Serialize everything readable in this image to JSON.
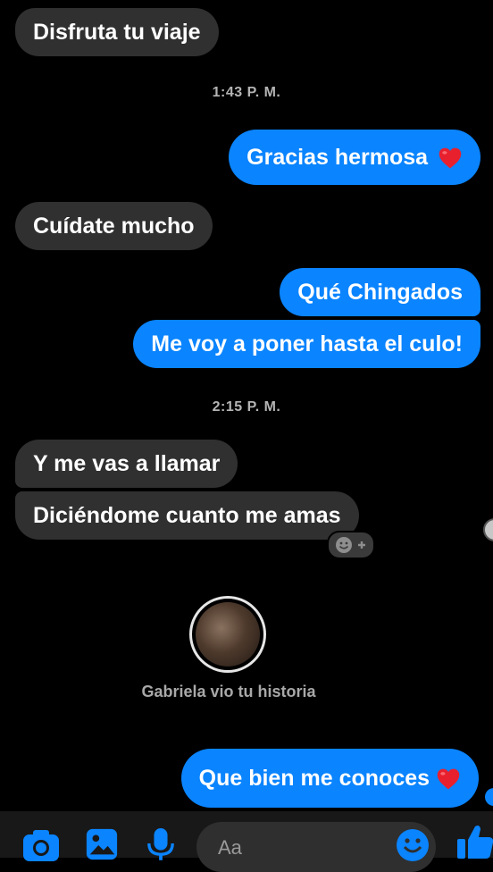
{
  "messages": [
    {
      "text": "Disfruta tu viaje"
    },
    {
      "text": "Gracias hermosa"
    },
    {
      "text": "Cuídate mucho"
    },
    {
      "text": "Qué Chingados"
    },
    {
      "text": "Me voy a poner hasta el culo!"
    },
    {
      "text": "Y me vas a llamar"
    },
    {
      "text": "Diciéndome cuanto me amas"
    },
    {
      "text": "Que bien me conoces"
    }
  ],
  "timestamps": [
    "1:43 P. M.",
    "2:15 P. M."
  ],
  "story": {
    "caption": "Gabriela vio tu historia"
  },
  "composer": {
    "placeholder": "Aa"
  },
  "colors": {
    "background": "#000000",
    "incoming_bubble": "#303030",
    "outgoing_bubble": "#0a84ff",
    "heart": "#e8202e"
  },
  "icons": [
    "camera-icon",
    "image-icon",
    "microphone-icon",
    "emoji-icon",
    "like-thumbs-up-icon",
    "heart-emoji-icon",
    "add-reaction-icon"
  ]
}
